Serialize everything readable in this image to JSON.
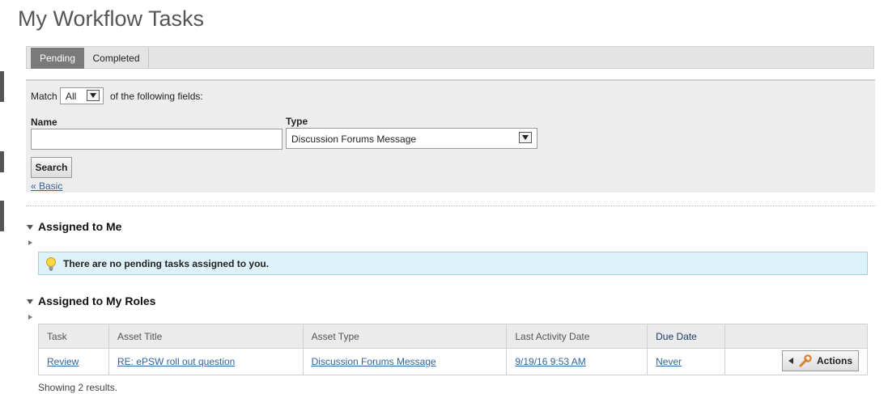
{
  "page": {
    "title": "My Workflow Tasks"
  },
  "tabs": [
    {
      "label": "Pending",
      "active": true
    },
    {
      "label": "Completed",
      "active": false
    }
  ],
  "filter": {
    "match_label": "Match",
    "match_value": "All",
    "match_suffix": "of the following fields:",
    "name_label": "Name",
    "name_value": "",
    "type_label": "Type",
    "type_value": "Discussion Forums Message",
    "search_button": "Search",
    "basic_link": "« Basic"
  },
  "assigned_to_me": {
    "heading": "Assigned to Me",
    "message": "There are no pending tasks assigned to you."
  },
  "assigned_to_roles": {
    "heading": "Assigned to My Roles",
    "columns": [
      "Task",
      "Asset Title",
      "Asset Type",
      "Last Activity Date",
      "Due Date",
      ""
    ],
    "rows": [
      {
        "task": "Review",
        "asset_title": "RE: ePSW roll out question",
        "asset_type": "Discussion Forums Message",
        "last_activity": "9/19/16 9:53 AM",
        "due_date": "Never",
        "action_label": "Actions"
      }
    ],
    "footer": "Showing 2 results."
  },
  "colors": {
    "active_tab": "#7a7a7a",
    "link": "#33649b",
    "info_background": "#def2fb",
    "info_border": "#a7cde0"
  },
  "icons": [
    "chevron-down-icon",
    "collapse-icon",
    "expand-icon",
    "lightbulb-icon",
    "caret-left-icon",
    "wrench-icon"
  ]
}
